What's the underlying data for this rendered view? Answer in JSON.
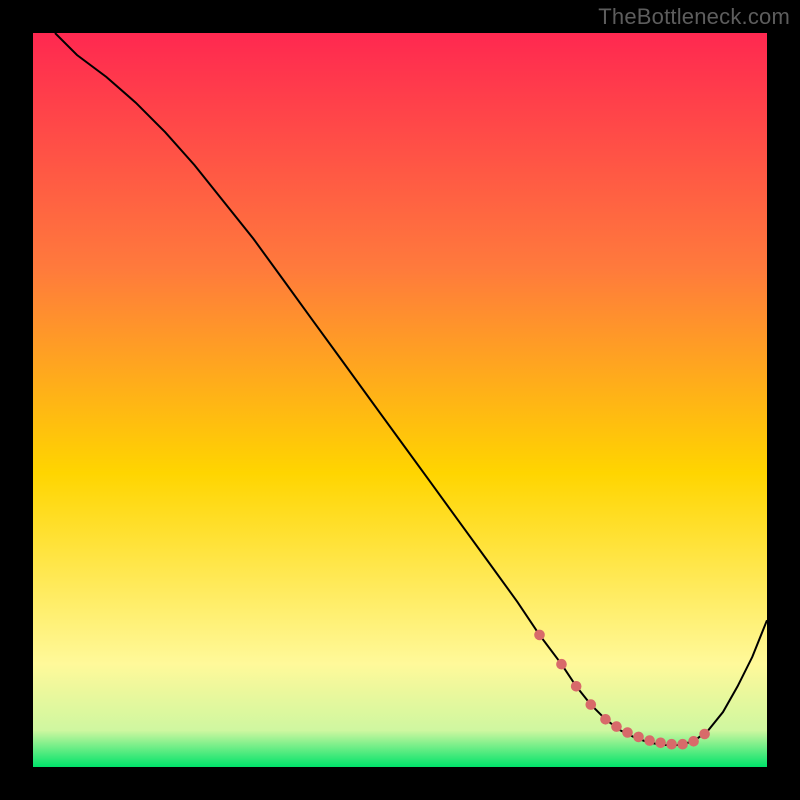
{
  "watermark": "TheBottleneck.com",
  "chart_data": {
    "type": "line",
    "title": "",
    "xlabel": "",
    "ylabel": "",
    "xlim": [
      0,
      100
    ],
    "ylim": [
      0,
      100
    ],
    "grid": false,
    "gradient": {
      "top": "#ff2850",
      "mid": "#ffd500",
      "bottom": "#00e36a"
    },
    "series": [
      {
        "name": "bottleneck-curve",
        "stroke": "#000000",
        "stroke_width": 2,
        "x": [
          3,
          6,
          10,
          14,
          18,
          22,
          26,
          30,
          34,
          38,
          42,
          46,
          50,
          54,
          58,
          62,
          66,
          69,
          72,
          74,
          76,
          78,
          80,
          82,
          84,
          86,
          88,
          90,
          92,
          94,
          96,
          98,
          100
        ],
        "values": [
          100,
          97,
          94,
          90.5,
          86.5,
          82,
          77,
          72,
          66.5,
          61,
          55.5,
          50,
          44.5,
          39,
          33.5,
          28,
          22.5,
          18,
          14,
          11,
          8.5,
          6.5,
          5,
          4,
          3.3,
          3,
          3,
          3.5,
          5,
          7.5,
          11,
          15,
          20
        ]
      },
      {
        "name": "optimal-range",
        "type": "scatter",
        "stroke": "#d86a6a",
        "marker_radius": 5.3,
        "x": [
          69,
          72,
          74,
          76,
          78,
          79.5,
          81,
          82.5,
          84,
          85.5,
          87,
          88.5,
          90,
          91.5
        ],
        "values": [
          18,
          14,
          11,
          8.5,
          6.5,
          5.5,
          4.7,
          4.1,
          3.6,
          3.3,
          3.1,
          3.1,
          3.5,
          4.5
        ]
      }
    ]
  }
}
